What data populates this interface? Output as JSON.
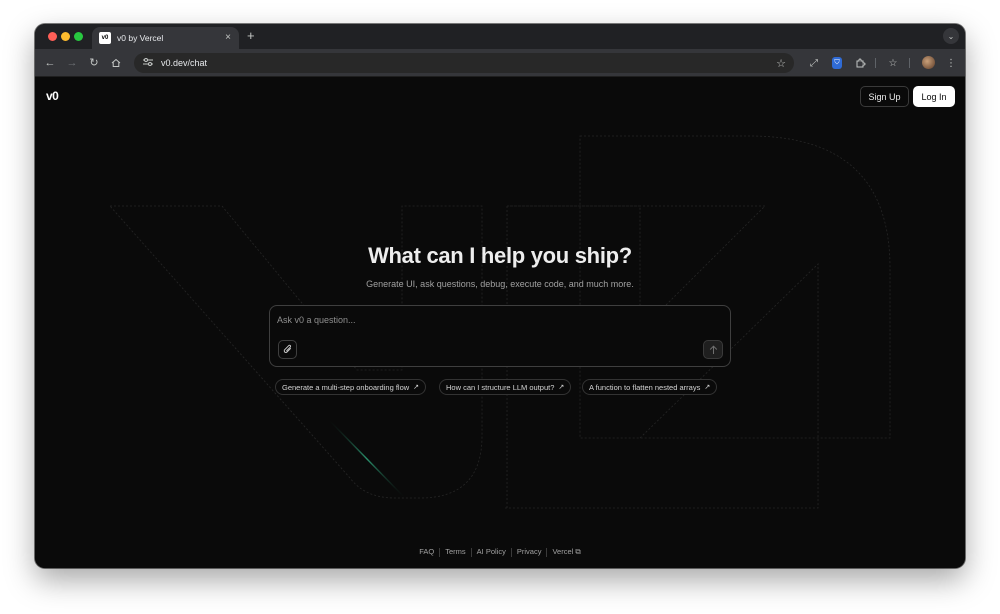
{
  "browser": {
    "tab_favicon": "v0",
    "tab_title": "v0 by Vercel",
    "tab_close_icon": "×",
    "new_tab_icon": "+",
    "tab_search_icon": "⌄",
    "url": "v0.dev/chat"
  },
  "header": {
    "logo": "v0",
    "signup_label": "Sign Up",
    "login_label": "Log In"
  },
  "main": {
    "title": "What can I help you ship?",
    "subtitle": "Generate UI, ask questions, debug, execute code, and much more.",
    "prompt_placeholder": "Ask v0 a question...",
    "suggestions": [
      "Generate a multi-step onboarding flow",
      "How can I structure LLM output?",
      "A function to flatten nested arrays"
    ],
    "suggestion_arrow": "↗"
  },
  "footer": {
    "links": [
      "FAQ",
      "Terms",
      "AI Policy",
      "Privacy",
      "Vercel"
    ],
    "external_icon": "⧉"
  },
  "colors": {
    "page_bg": "#0a0a0a",
    "browser_chrome": "#35363a",
    "text_primary": "#ededed",
    "text_muted": "#a1a1a1",
    "accent_green": "#2fa37a"
  }
}
